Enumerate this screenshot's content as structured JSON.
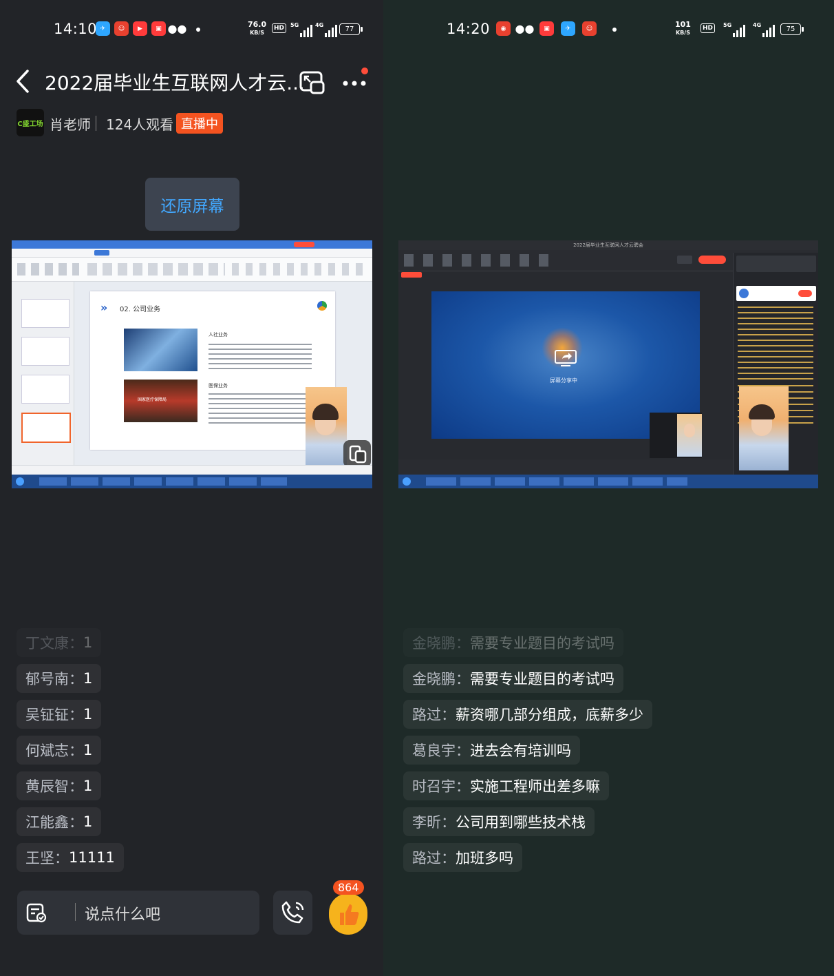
{
  "left": {
    "status": {
      "time": "14:10",
      "speed_value": "76.0",
      "speed_unit": "KB/S",
      "hd": "HD",
      "net1": "5G",
      "net2": "4G",
      "battery": "77"
    },
    "header": {
      "title": "2022届毕业生互联网人才云..."
    },
    "host": {
      "logo_text": "C盛工场",
      "name": "肖老师",
      "viewers": "124人观看",
      "live": "直播中"
    },
    "restore_label": "还原屏幕",
    "slide": {
      "heading": "02. 公司业务",
      "section1": "人社业务",
      "section2": "医保业务",
      "sign": "国家医疗保障局"
    },
    "comments": [
      {
        "user": "丁文康",
        "text": "1",
        "faded": true
      },
      {
        "user": "郁号南",
        "text": "1"
      },
      {
        "user": "吴钲钲",
        "text": "1"
      },
      {
        "user": "何斌志",
        "text": "1"
      },
      {
        "user": "黄辰智",
        "text": "1"
      },
      {
        "user": "江能鑫",
        "text": "1"
      },
      {
        "user": "王坚",
        "text": "11111"
      }
    ],
    "input_placeholder": "说点什么吧",
    "like_count": "864"
  },
  "right": {
    "status": {
      "time": "14:20",
      "speed_value": "101",
      "speed_unit": "KB/S",
      "hd": "HD",
      "net1": "5G",
      "net2": "4G",
      "battery": "75"
    },
    "screen": {
      "window_title": "2022届毕业生互联网人才云聘会",
      "sharing": "屏幕分享中"
    },
    "comments": [
      {
        "user": "金晓鹏",
        "text": "需要专业题目的考试吗",
        "faded": true
      },
      {
        "user": "金晓鹏",
        "text": "需要专业题目的考试吗"
      },
      {
        "user": "路过",
        "text": "薪资哪几部分组成，底薪多少"
      },
      {
        "user": "葛良宇",
        "text": "进去会有培训吗"
      },
      {
        "user": "时召宇",
        "text": "实施工程师出差多嘛"
      },
      {
        "user": "李昕",
        "text": "公司用到哪些技术栈"
      },
      {
        "user": "路过",
        "text": "加班多吗"
      }
    ]
  }
}
